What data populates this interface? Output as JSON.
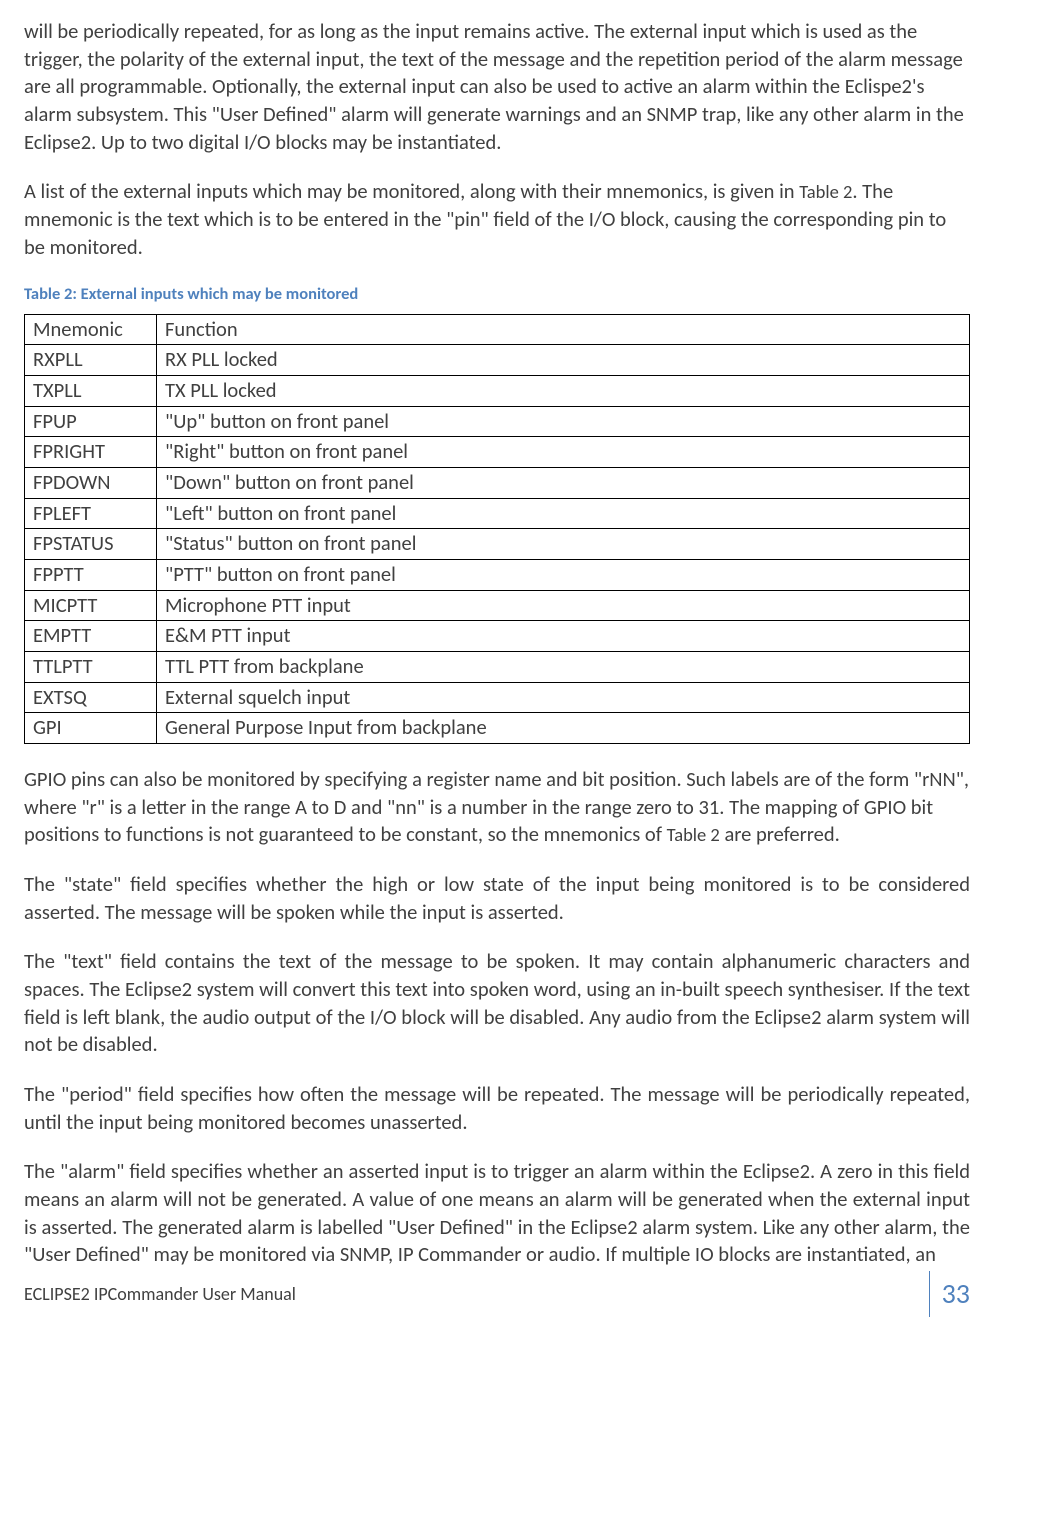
{
  "paragraphs": {
    "p1": "will be periodically repeated, for as long as the input remains active.  The external input which is used as the trigger, the polarity of the external input, the text of the message and the repetition period of the alarm message are all programmable.  Optionally, the external input can also be used to active an alarm within the Eclispe2's alarm subsystem.  This \"User Defined\" alarm will generate warnings and an SNMP trap, like any other alarm in the Eclipse2.  Up to two digital I/O blocks may be instantiated.",
    "p2_a": "A list of the external inputs which may be monitored, along with their mnemonics, is given in ",
    "p2_ref": "Table 2",
    "p2_b": ".  The mnemonic is the text which is to be entered in the \"pin\" field of the I/O block, causing the corresponding pin to be monitored.",
    "p3_a": "GPIO pins can also be monitored by specifying a register name and bit position.  Such labels are of the form \"rNN\", where \"r\" is a letter in the range A to D and \"nn\" is a number in the range zero to 31. The mapping of GPIO bit positions to functions is not guaranteed to be constant, so the mnemonics of ",
    "p3_ref": "Table 2",
    "p3_b": " are preferred.",
    "p4": "The \"state\" field specifies whether the high or low state of the input being monitored is to be considered asserted.  The message will be spoken while the input is asserted.",
    "p5": "The \"text\" field contains the text of the message to be spoken.  It may contain alphanumeric characters and spaces.  The Eclipse2 system will convert this text into spoken word, using an in-built speech synthesiser.  If the text field is left blank, the audio output of the I/O block will be disabled.  Any audio from the Eclipse2 alarm system will not be disabled.",
    "p6": "The \"period\" field specifies how often the message will be repeated.  The message will be periodically repeated, until the input being monitored becomes unasserted.",
    "p7": "The \"alarm\" field specifies whether an asserted input is to trigger an alarm within the Eclipse2.  A zero in this field means an alarm will not be generated.  A value of one means an alarm will be generated when the external input is asserted.  The generated alarm is labelled \"User Defined\" in the Eclipse2 alarm system. Like any other alarm, the \"User Defined\" may be monitored via SNMP, IP Commander or audio.  If multiple IO blocks are instantiated, an"
  },
  "table_caption": "Table 2: External inputs which may be monitored",
  "table": {
    "headers": {
      "c1": "Mnemonic",
      "c2": "Function"
    },
    "rows": [
      {
        "c1": "RXPLL",
        "c2": "RX PLL locked"
      },
      {
        "c1": "TXPLL",
        "c2": "TX PLL locked"
      },
      {
        "c1": "FPUP",
        "c2": "\"Up\" button on front panel"
      },
      {
        "c1": "FPRIGHT",
        "c2": "\"Right\" button on front panel"
      },
      {
        "c1": "FPDOWN",
        "c2": "\"Down\" button on front panel"
      },
      {
        "c1": "FPLEFT",
        "c2": "\"Left\" button on front panel"
      },
      {
        "c1": "FPSTATUS",
        "c2": "\"Status\" button on front panel"
      },
      {
        "c1": "FPPTT",
        "c2": "\"PTT\" button on front panel"
      },
      {
        "c1": "MICPTT",
        "c2": "Microphone PTT input"
      },
      {
        "c1": "EMPTT",
        "c2": "E&M PTT input"
      },
      {
        "c1": "TTLPTT",
        "c2": "TTL PTT from backplane"
      },
      {
        "c1": "EXTSQ",
        "c2": "External squelch input"
      },
      {
        "c1": "GPI",
        "c2": "General Purpose Input from backplane"
      }
    ]
  },
  "footer": {
    "title": "ECLIPSE2 IPCommander User Manual",
    "page": "33"
  }
}
